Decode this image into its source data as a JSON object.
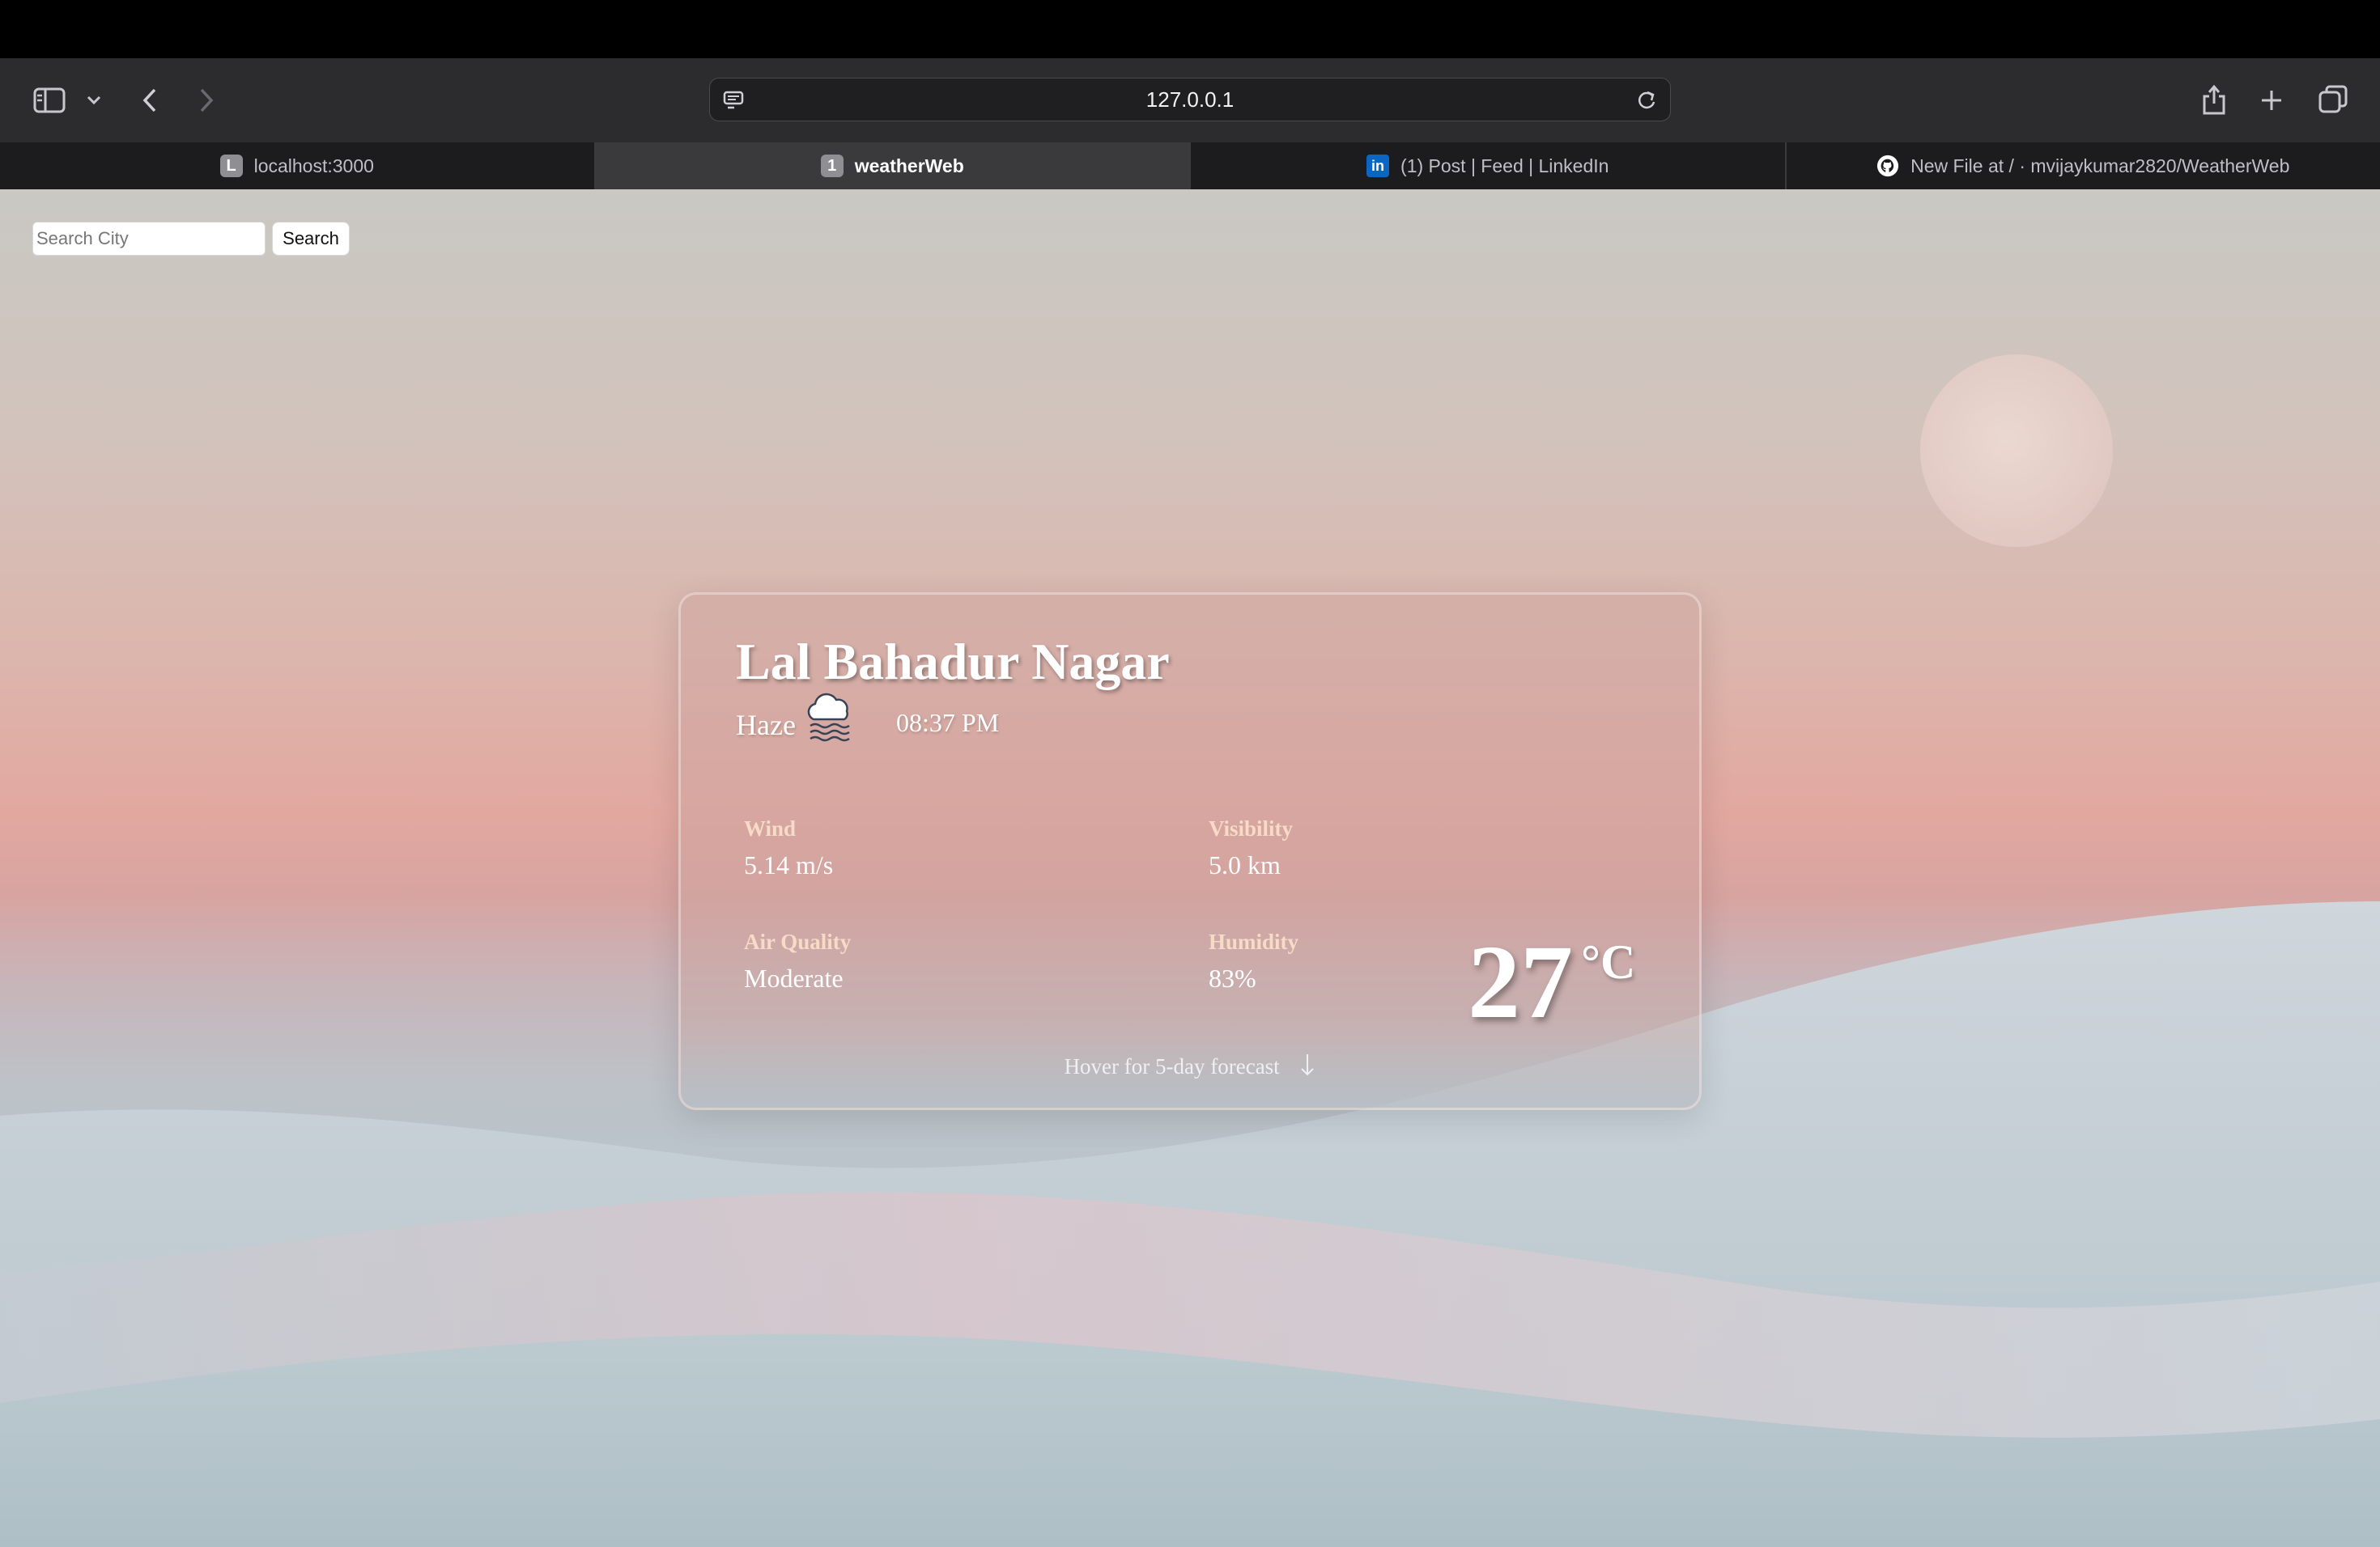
{
  "browser": {
    "address": "127.0.0.1",
    "tabs": [
      {
        "favicon": "L",
        "label": "localhost:3000",
        "active": false
      },
      {
        "favicon": "1",
        "label": "weatherWeb",
        "active": true
      },
      {
        "favicon": "in",
        "label": "(1) Post | Feed | LinkedIn",
        "active": false
      },
      {
        "favicon": "github-icon",
        "label": "New File at / · mvijaykumar2820/WeatherWeb",
        "active": false
      }
    ]
  },
  "search": {
    "placeholder": "Search City",
    "value": "",
    "button_label": "Search"
  },
  "weather": {
    "city": "Lal Bahadur Nagar",
    "condition": "Haze",
    "condition_icon": "haze-cloud-icon",
    "time": "08:37 PM",
    "metrics": {
      "wind": {
        "label": "Wind",
        "value": "5.14 m/s"
      },
      "visibility": {
        "label": "Visibility",
        "value": "5.0 km"
      },
      "air_quality": {
        "label": "Air Quality",
        "value": "Moderate"
      },
      "humidity": {
        "label": "Humidity",
        "value": "83%"
      }
    },
    "temperature": "27",
    "unit": "°C",
    "forecast_hint": "Hover for 5-day forecast"
  }
}
